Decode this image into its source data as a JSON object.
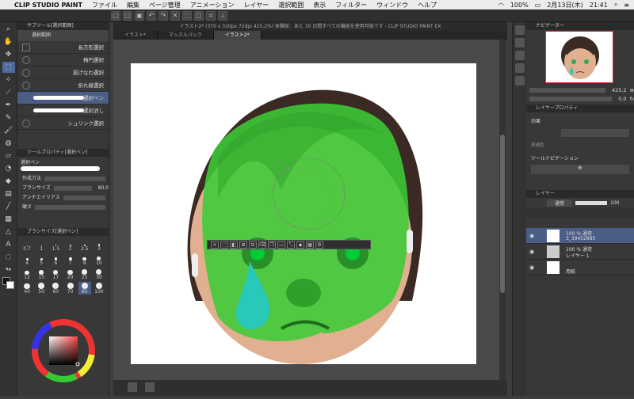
{
  "menubar": {
    "apple": "",
    "app_name": "CLIP STUDIO PAINT",
    "items": [
      "ファイル",
      "編集",
      "ページ管理",
      "アニメーション",
      "レイヤー",
      "選択範囲",
      "表示",
      "フィルター",
      "ウィンドウ",
      "ヘルプ"
    ],
    "battery": "100%",
    "date": "2月13日(木)",
    "time": "21:41"
  },
  "document": {
    "title": "イラスト2* (370 x 320px 72dpi 425.2%) 体験版：あと 30 日間すべての機能を使用可能です - CLIP STUDIO PAINT EX",
    "tabs": [
      "イラスト*",
      "マッスルパック",
      "イラスト2*"
    ]
  },
  "subtool": {
    "header": "サブツール[選択範囲]",
    "group": "選択範囲",
    "items": [
      "長方形選択",
      "楕円選択",
      "投げなわ選択",
      "折れ線選択",
      "選択ペン",
      "選択消し",
      "シュリンク選択"
    ],
    "selected_index": 4
  },
  "toolprop": {
    "header": "ツールプロパティ[選択ペン]",
    "brush_name": "選択ペン",
    "mode_label": "作成方法",
    "size_label": "ブラシサイズ",
    "size_value": "80.0",
    "aa_label": "アンチエイリアス",
    "hardness_label": "硬さ"
  },
  "brushsize": {
    "header": "ブラシサイズ[選択ペン]",
    "sizes": [
      "0.7",
      "1",
      "1.5",
      "2",
      "2.5",
      "3",
      "4",
      "5",
      "6",
      "7",
      "8",
      "10",
      "12",
      "15",
      "17",
      "20",
      "25",
      "30",
      "40",
      "50",
      "60",
      "70",
      "80",
      "100"
    ],
    "selected": "80"
  },
  "navigator": {
    "header": "ナビゲーター",
    "zoom": "425.2",
    "rotation": "0.0"
  },
  "layerprop": {
    "header": "レイヤープロパティ",
    "effect_label": "効果",
    "expression_label": "表現色",
    "toolnav_label": "ツールナビゲーション"
  },
  "layers": {
    "header": "レイヤー",
    "blend": "通常",
    "opacity": "100",
    "rows": [
      {
        "line1": "100 % 通常",
        "line2": "S_39452885"
      },
      {
        "line1": "100 % 通常",
        "line2": "レイヤー 1"
      },
      {
        "line1": "",
        "line2": "用紙"
      }
    ]
  }
}
